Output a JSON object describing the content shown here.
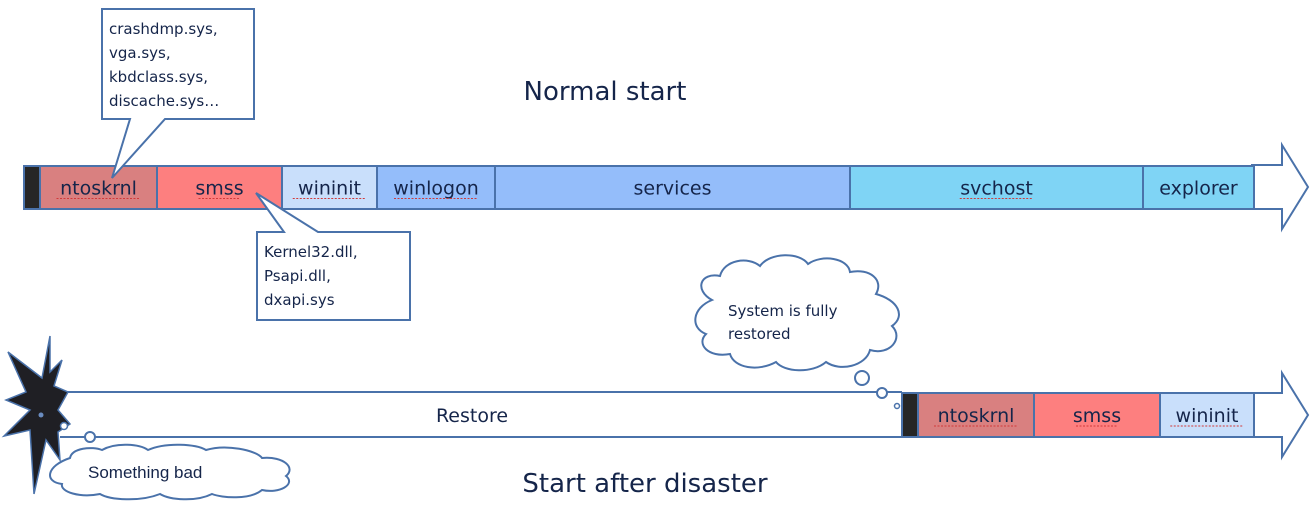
{
  "titles": {
    "normal": "Normal start",
    "disaster": "Start after disaster"
  },
  "normal_timeline": {
    "segments": [
      {
        "label": "",
        "color": "#262626"
      },
      {
        "label": "ntoskrnl",
        "color": "#d98080"
      },
      {
        "label": "smss",
        "color": "#fd7f7f"
      },
      {
        "label": "wininit",
        "color": "#c9dffb"
      },
      {
        "label": "winlogon",
        "color": "#94bdfa"
      },
      {
        "label": "services",
        "color": "#94bdfa"
      },
      {
        "label": "svchost",
        "color": "#7fd4f5"
      },
      {
        "label": "explorer",
        "color": "#7fd4f5"
      }
    ]
  },
  "callouts": {
    "ntoskrnl": {
      "lines": [
        "crashdmp.sys,",
        "vga.sys,",
        "kbdclass.sys,",
        "discache.sys…"
      ]
    },
    "smss": {
      "lines": [
        "Kernel32.dll,",
        "Psapi.dll,",
        "dxapi.sys"
      ]
    }
  },
  "disaster_timeline": {
    "restore_label": "Restore",
    "segments": [
      {
        "label": "",
        "color": "#262626"
      },
      {
        "label": "ntoskrnl",
        "color": "#d98080"
      },
      {
        "label": "smss",
        "color": "#fd7f7f"
      },
      {
        "label": "wininit",
        "color": "#c9dffb"
      }
    ]
  },
  "thought_bubbles": {
    "restored": {
      "lines": [
        "System is fully",
        "restored"
      ]
    },
    "bad": {
      "text": "Something bad"
    }
  },
  "colors": {
    "outline": "#4a72aa",
    "text": "#15254a"
  }
}
